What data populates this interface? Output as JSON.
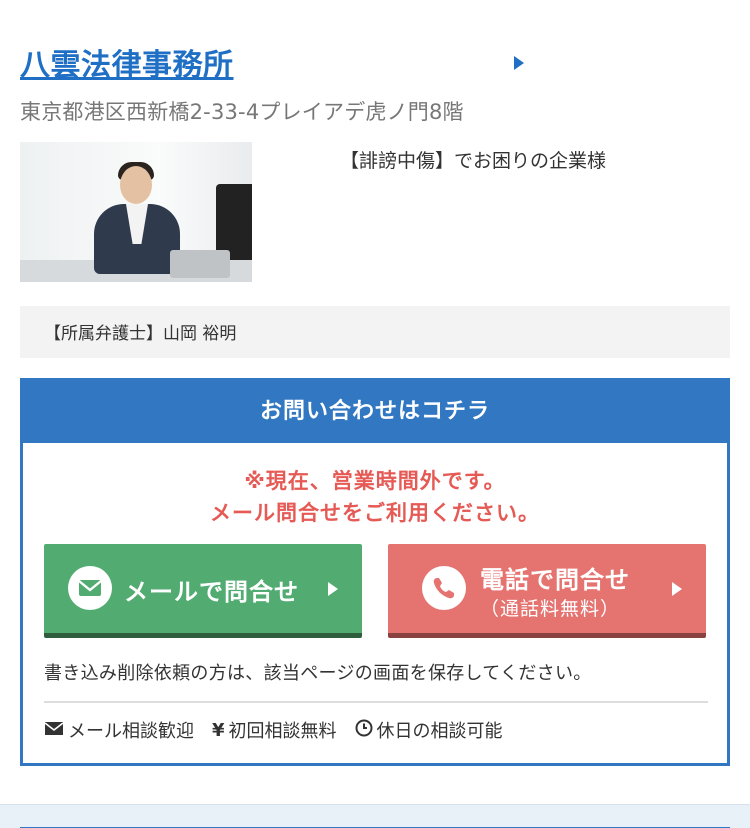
{
  "firm": {
    "name": "八雲法律事務所",
    "address": "東京都港区西新橋2-33-4プレイアデ虎ノ門8階"
  },
  "profile": {
    "tagline": "【誹謗中傷】でお困りの企業様",
    "lawyer": "【所属弁護士】山岡 裕明"
  },
  "contact": {
    "header": "お問い合わせはコチラ",
    "notice_line1": "※現在、営業時間外です。",
    "notice_line2": "メール問合せをご利用ください。",
    "mail_button": "メールで問合せ",
    "tel_button": "電話で問合せ",
    "tel_button_sub": "（通話料無料）",
    "delete_note": "書き込み削除依頼の方は、該当ページの画面を保存してください。",
    "features": [
      {
        "icon": "envelope-icon",
        "label": "メール相談歓迎"
      },
      {
        "icon": "yen-icon",
        "label": "初回相談無料"
      },
      {
        "icon": "clock-icon",
        "label": "休日の相談可能"
      }
    ],
    "yen_symbol": "¥"
  },
  "colors": {
    "link_blue": "#1f6fc5",
    "header_blue": "#3177c2",
    "notice_red": "#e55a55",
    "mail_green": "#52ac72",
    "tel_red": "#e57471"
  }
}
